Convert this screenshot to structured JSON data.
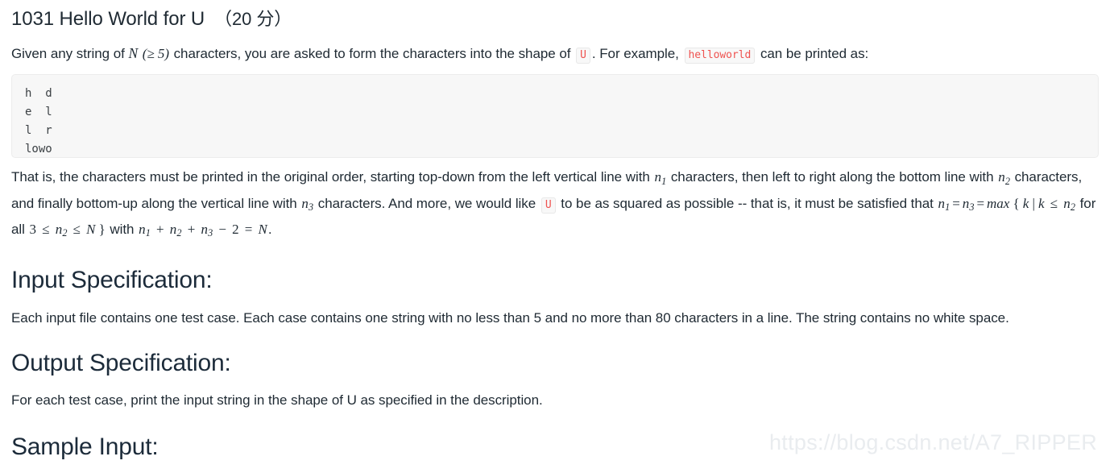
{
  "title": {
    "text": "1031 Hello World for U",
    "score": "（20 分）"
  },
  "intro": {
    "seg1": "Given any string of ",
    "math_n": "N",
    "math_ge5": "(≥ 5)",
    "seg2": " characters, you are asked to form the characters into the shape of ",
    "code_u": "U",
    "seg3": ". For example, ",
    "code_helloworld": "helloworld",
    "seg4": " can be printed as:"
  },
  "code_block": {
    "lines": [
      "h  d",
      "e  l",
      "l  r",
      "lowo"
    ],
    "text": "h  d\ne  l\nl  r\nlowo"
  },
  "detail": {
    "seg1": "That is, the characters must be printed in the original order, starting top-down from the left vertical line with ",
    "n1": "n",
    "n1_sub": "1",
    "seg2": " characters, then left to right along the bottom line with ",
    "n2": "n",
    "n2_sub": "2",
    "seg3": " characters, and finally bottom-up along the vertical line with ",
    "n3": "n",
    "n3_sub": "3",
    "seg4": " characters. And more, we would like ",
    "code_u": "U",
    "seg5": " to be as squared as possible -- that is, it must be satisfied that ",
    "formula": "n1 = n3 = max { k | k ≤ n2 for all 3 ≤ n2 ≤ N } with n1 + n2 + n3 − 2 = N.",
    "seg6": "."
  },
  "input_section": {
    "heading": "Input Specification:",
    "body": "Each input file contains one test case. Each case contains one string with no less than 5 and no more than 80 characters in a line. The string contains no white space."
  },
  "output_section": {
    "heading": "Output Specification:",
    "body": "For each test case, print the input string in the shape of U as specified in the description."
  },
  "sample_section": {
    "heading": "Sample Input:"
  },
  "watermark": {
    "text": "https://blog.csdn.net/A7_RIPPER"
  },
  "colors": {
    "text": "#1f2a33",
    "heading": "#1c2b3a",
    "code_text": "#3b4044",
    "inline_code_text": "#ef5350",
    "code_bg": "#f7f7f7",
    "watermark": "#e9ecef"
  }
}
